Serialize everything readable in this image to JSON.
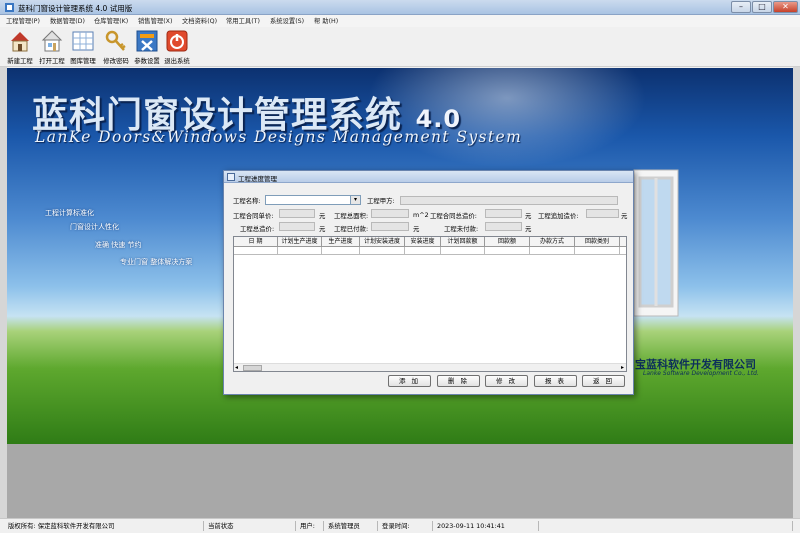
{
  "window": {
    "title": "蓝科门窗设计管理系统 4.0 试用版",
    "controls": {
      "minimize": "–",
      "maximize": "□",
      "close": "✕"
    }
  },
  "menu": [
    "工程管理(P)",
    "数据管理(D)",
    "仓库管理(K)",
    "销售管理(X)",
    "文档资料(Q)",
    "常用工具(T)",
    "系统设置(S)",
    "帮 助(H)"
  ],
  "toolbar": [
    {
      "label": "新建工程",
      "icon": "new-project-icon"
    },
    {
      "label": "打开工程",
      "icon": "open-project-icon"
    },
    {
      "label": "图库管理",
      "icon": "gallery-icon"
    },
    {
      "label": "修改密码",
      "icon": "key-icon"
    },
    {
      "label": "参数设置",
      "icon": "settings-icon"
    },
    {
      "label": "退出系统",
      "icon": "power-icon"
    }
  ],
  "banner": {
    "title_cn": "蓝科门窗设计管理系统",
    "version": "4.0",
    "title_en": "LanKe Doors&Windows Designs Management System",
    "slogans": [
      "工程计算标准化",
      "门窗设计人性化",
      "准确 快速 节约",
      "专业门窗 整体解决方案"
    ],
    "company_cn": "宝蓝科软件开发有限公司",
    "company_en": "Lanke Software Development Co., Ltd."
  },
  "dialog": {
    "title": "工程进度管理",
    "fields": {
      "project_name_label": "工程名称:",
      "party_a_label": "工程甲方:",
      "contract_unit_price_label": "工程合同单价:",
      "yuan": "元",
      "total_area_label": "工程总面积:",
      "area_unit": "m^2",
      "contract_total_label": "工程合同总造价:",
      "add_cost_label": "工程追加造价:",
      "total_cost_label": "工程总造价:",
      "paid_label": "工程已付款:",
      "unpaid_label": "工程未付款:"
    },
    "table_headers": [
      "日 期",
      "计划生产进度",
      "生产进度",
      "计划安装进度",
      "安装进度",
      "计划回款额",
      "回款额",
      "办款方式",
      "回款类别"
    ],
    "scroll_left": "◂",
    "scroll_right": "▸",
    "buttons": {
      "add": "添 加",
      "delete": "删 除",
      "edit": "修 改",
      "report": "报 表",
      "back": "返 回"
    }
  },
  "statusbar": {
    "copyright": "版权所有: 保定蓝科软件开发有限公司",
    "state_label": "当前状态",
    "user_label": "用户:",
    "user": "系统管理员",
    "login_label": "登录时间:",
    "login_time": "2023-09-11  10:41:41"
  }
}
